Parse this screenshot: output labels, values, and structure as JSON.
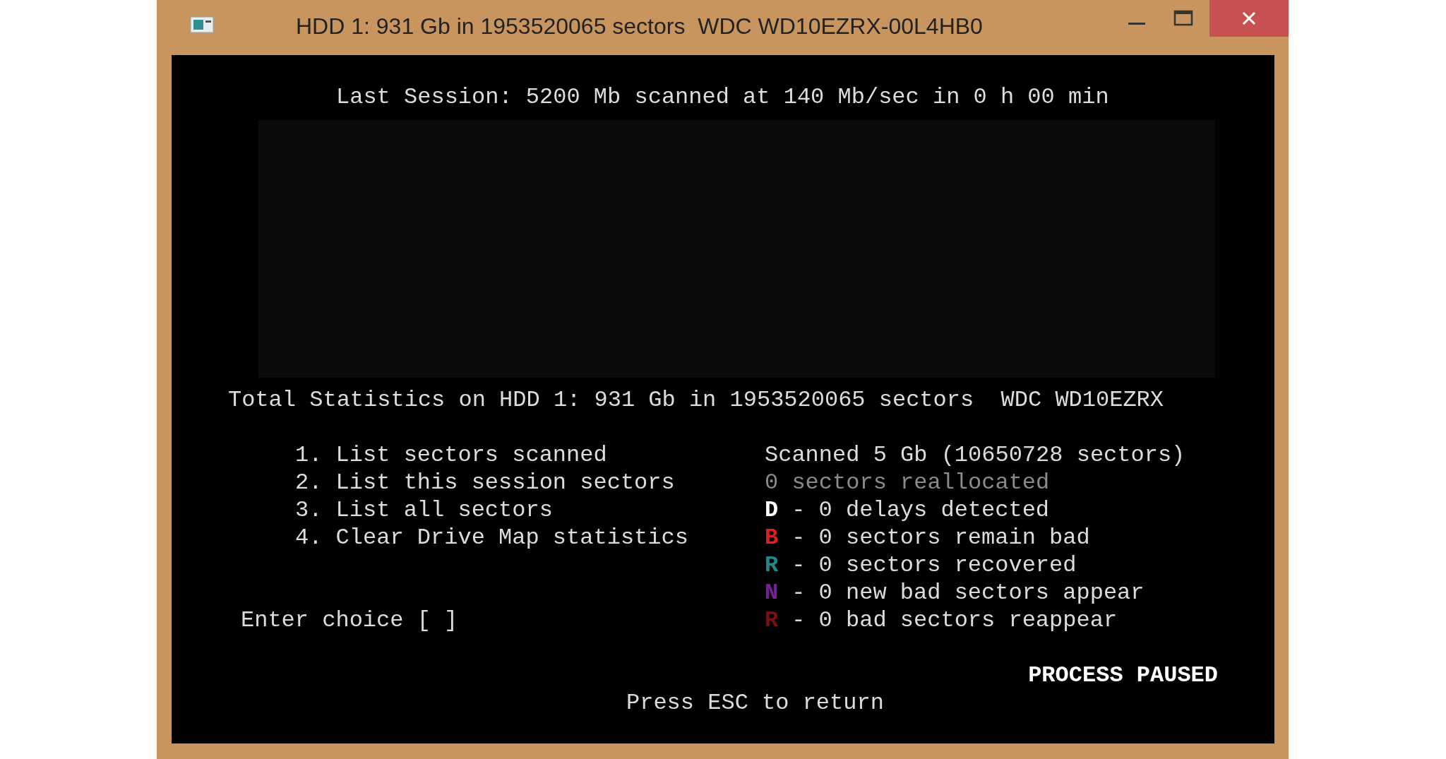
{
  "window": {
    "title": "HDD 1: 931 Gb in 1953520065 sectors  WDC WD10EZRX-00L4HB0"
  },
  "console": {
    "session": "Last Session: 5200 Mb scanned at 140 Mb/sec in 0 h 00 min",
    "total": "Total Statistics on HDD 1: 931 Gb in 1953520065 sectors  WDC WD10EZRX",
    "menu": [
      "1. List sectors scanned",
      "2. List this session sectors",
      "3. List all sectors",
      "4. Clear Drive Map statistics"
    ],
    "stats": [
      {
        "kind": "summary",
        "text": "Scanned 5 Gb (10650728 sectors)"
      },
      {
        "kind": "dim",
        "text": "0 sectors reallocated"
      },
      {
        "kind": "legend",
        "key": "D",
        "color": "#ffffff",
        "text": "- 0 delays detected"
      },
      {
        "kind": "legend",
        "key": "B",
        "color": "#e02020",
        "text": "- 0 sectors remain bad"
      },
      {
        "kind": "legend",
        "key": "R",
        "color": "#1f8a8a",
        "text": "- 0 sectors recovered"
      },
      {
        "kind": "legend",
        "key": "N",
        "color": "#7a1f9a",
        "text": "- 0 new bad sectors appear"
      },
      {
        "kind": "legend",
        "key": "R",
        "color": "#7a1010",
        "text": "- 0 bad sectors reappear"
      }
    ],
    "prompt": "Enter choice [ ]",
    "status": "PROCESS PAUSED",
    "hint": "Press ESC to return"
  }
}
